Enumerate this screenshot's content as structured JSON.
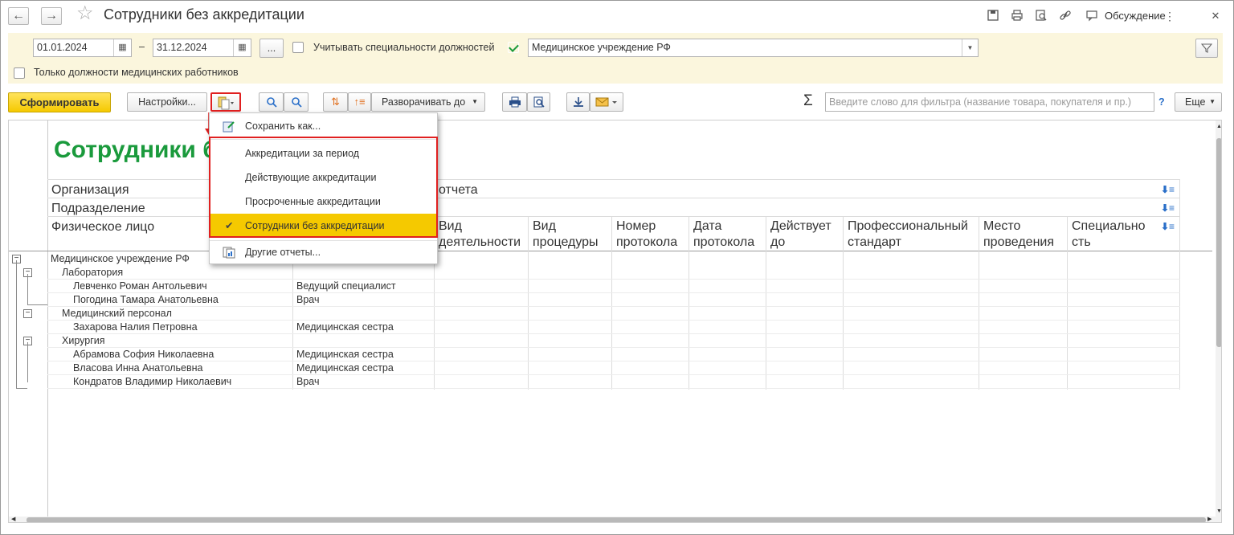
{
  "window": {
    "title": "Сотрудники без аккредитации",
    "discussion_label": "Обсуждение"
  },
  "filters": {
    "date_from": "01.01.2024",
    "date_sep": "–",
    "date_to": "31.12.2024",
    "period_button": "...",
    "use_specialties_label": "Учитывать специальности должностей",
    "use_specialties_checked": false,
    "org_checked": true,
    "organization": "Медицинское учреждение РФ",
    "only_medical_label": "Только должности медицинских работников",
    "only_medical_checked": false
  },
  "toolbar": {
    "generate_label": "Сформировать",
    "settings_label": "Настройки...",
    "expand_label": "Разворачивать до",
    "search_placeholder": "Введите слово для фильтра (название товара, покупателя и пр.)",
    "help_label": "?",
    "more_label": "Еще"
  },
  "dropdown": {
    "save_as": "Сохранить как...",
    "variants": [
      {
        "label": "Аккредитации за период",
        "checked": false
      },
      {
        "label": "Действующие аккредитации",
        "checked": false
      },
      {
        "label": "Просроченные аккредитации",
        "checked": false
      },
      {
        "label": "Сотрудники без аккредитации",
        "checked": true
      }
    ],
    "other_reports": "Другие отчеты..."
  },
  "report": {
    "title": "Сотрудники б",
    "group_headers": [
      "Организация",
      "Подразделение",
      "Физическое лицо"
    ],
    "header_right": "отчета",
    "columns": [
      "Вид\nдеятельности",
      "Вид\nпроцедуры",
      "Номер\nпротокола",
      "Дата\nпротокола",
      "Действует\nдо",
      "Профессиональный\nстандарт",
      "Место\nпроведения",
      "Специально\nсть"
    ],
    "rows": [
      {
        "level": 0,
        "name": "Медицинское учреждение РФ",
        "position": ""
      },
      {
        "level": 1,
        "name": "Лаборатория",
        "position": ""
      },
      {
        "level": 2,
        "name": "Левченко Роман Антольевич",
        "position": "Ведущий специалист"
      },
      {
        "level": 2,
        "name": "Погодина Тамара Анатольевна",
        "position": "Врач"
      },
      {
        "level": 1,
        "name": "Медицинский персонал",
        "position": ""
      },
      {
        "level": 2,
        "name": "Захарова Налия Петровна",
        "position": "Медицинская сестра"
      },
      {
        "level": 1,
        "name": "Хирургия",
        "position": ""
      },
      {
        "level": 2,
        "name": "Абрамова София Николаевна",
        "position": "Медицинская сестра"
      },
      {
        "level": 2,
        "name": "Власова Инна Анатольевна",
        "position": "Медицинская сестра"
      },
      {
        "level": 2,
        "name": "Кондратов Владимир Николаевич",
        "position": "Врач"
      }
    ]
  },
  "colors": {
    "accent_yellow": "#f5c900",
    "title_green": "#1a9a3c",
    "highlight_red": "#e02020",
    "panel_bg": "#fbf6dd"
  }
}
